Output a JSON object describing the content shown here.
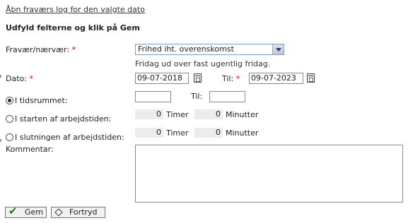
{
  "top_link": "Åbn fraværs log for den valgte dato",
  "section_title": "Udfyld felterne og klik på Gem",
  "form": {
    "absence_label": "Fravær/nærvær:",
    "required_mark": "*",
    "absence_value": "Frihed iht. overenskomst",
    "absence_hint": "Fridag ud over fast ugentlig fridag.",
    "date_label": "Dato:",
    "date_from": "09-07-2018",
    "to_label": "Til:",
    "date_to": "09-07-2023",
    "radio_period_label": "I tidsrummet:",
    "period_to_label": "Til:",
    "radio_start_label": "I starten af arbejdstiden:",
    "radio_end_label": "I slutningen af arbejdstiden:",
    "hours_value": "0",
    "hours_label": "Timer",
    "minutes_value": "0",
    "minutes_label": "Minutter",
    "comment_label": "Kommentar:"
  },
  "buttons": {
    "save": "Gem",
    "cancel": "Fortryd"
  },
  "icons": {
    "calendar": "calendar-icon",
    "dropdown": "chevron-down-icon",
    "save": "checkmark-icon",
    "cancel": "diamond-icon"
  },
  "colors": {
    "required": "#e00000",
    "save_check": "#0a8a0a"
  }
}
